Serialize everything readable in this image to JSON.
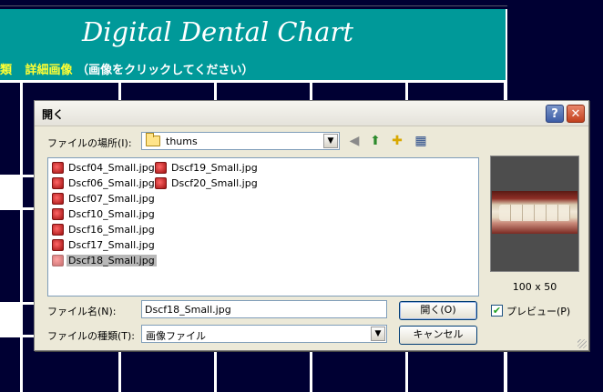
{
  "background_page": {
    "banner_title": "Digital Dental Chart",
    "banner_fragment_left": "類",
    "banner_link": "詳細画像",
    "banner_note": "（画像をクリックしてください）"
  },
  "dialog": {
    "title": "開く",
    "help_label": "?",
    "close_label": "✕",
    "location_label": "ファイルの場所(I):",
    "location_value": "thums",
    "files": [
      "Dscf04_Small.jpg",
      "Dscf06_Small.jpg",
      "Dscf07_Small.jpg",
      "Dscf10_Small.jpg",
      "Dscf16_Small.jpg",
      "Dscf17_Small.jpg",
      "Dscf18_Small.jpg",
      "Dscf19_Small.jpg",
      "Dscf20_Small.jpg"
    ],
    "selected_file": "Dscf18_Small.jpg",
    "preview_size": "100 x 50",
    "filename_label": "ファイル名(N):",
    "filename_value": "Dscf18_Small.jpg",
    "filetype_label": "ファイルの種類(T):",
    "filetype_value": "画像ファイル",
    "open_button": "開く(O)",
    "cancel_button": "キャンセル",
    "preview_checkbox_label": "プレビュー(P)",
    "preview_checked": true
  }
}
